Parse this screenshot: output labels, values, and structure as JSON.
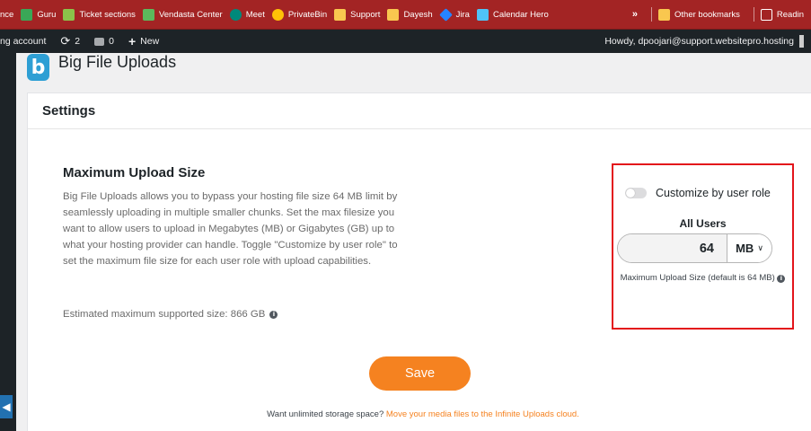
{
  "bookmarks": [
    {
      "label": "nce",
      "color": ""
    },
    {
      "label": "Guru",
      "color": "#3aa757"
    },
    {
      "label": "Ticket sections",
      "color": "#8bc34a"
    },
    {
      "label": "Vendasta Center",
      "color": "#5cb85c"
    },
    {
      "label": "Meet",
      "color": "#00897b"
    },
    {
      "label": "PrivateBin",
      "color": "#ffc107"
    },
    {
      "label": "Support",
      "color": "#f9c74f"
    },
    {
      "label": "Dayesh",
      "color": "#f9c74f"
    },
    {
      "label": "Jira",
      "color": "#2684ff"
    },
    {
      "label": "Calendar Hero",
      "color": "#4fc3f7"
    }
  ],
  "bookmarks_overflow": "»",
  "bookmarks_other": "Other bookmarks",
  "bookmarks_reading": "Readin",
  "adminbar": {
    "account": "ng account",
    "updates": "2",
    "comments": "0",
    "new": "New",
    "howdy": "Howdy, dpoojari@support.websitepro.hosting"
  },
  "plugin": {
    "logo_letter": "b",
    "title": "Big File Uploads"
  },
  "card": {
    "header": "Settings",
    "section_title": "Maximum Upload Size",
    "description": "Big File Uploads allows you to bypass your hosting file size 64 MB limit by seamlessly uploading in multiple smaller chunks. Set the max filesize you want to allow users to upload in Megabytes (MB) or Gigabytes (GB) up to what your hosting provider can handle. Toggle \"Customize by user role\" to set the maximum file size for each user role with upload capabilities.",
    "estimate": "Estimated maximum supported size: 866 GB"
  },
  "settings_panel": {
    "toggle_label": "Customize by user role",
    "toggle_on": false,
    "all_users": "All Users",
    "size_value": "64",
    "unit": "MB",
    "hint": "Maximum Upload Size (default is 64 MB)"
  },
  "save_label": "Save",
  "footer": {
    "text": "Want unlimited storage space?",
    "link": "Move your media files to the Infinite Uploads cloud."
  },
  "colors": {
    "accent": "#f58220",
    "highlight_border": "#e3141b"
  }
}
